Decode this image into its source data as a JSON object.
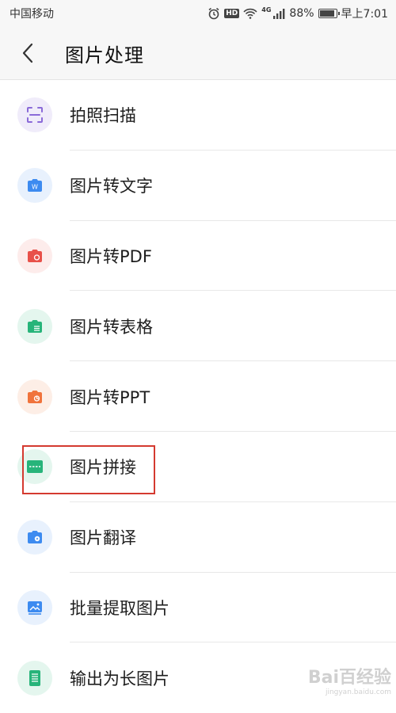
{
  "status_bar": {
    "carrier": "中国移动",
    "network": "4G",
    "battery": "88%",
    "time": "早上7:01",
    "hd": "HD"
  },
  "header": {
    "title": "图片处理"
  },
  "items": [
    {
      "label": "拍照扫描",
      "icon": "scan-icon",
      "color": "#8a6ad8",
      "bg": "#f0ecfa"
    },
    {
      "label": "图片转文字",
      "icon": "camera-text-icon",
      "color": "#3d8bf0",
      "bg": "#e8f1fd"
    },
    {
      "label": "图片转PDF",
      "icon": "camera-pdf-icon",
      "color": "#e8514a",
      "bg": "#fdeceb"
    },
    {
      "label": "图片转表格",
      "icon": "camera-table-icon",
      "color": "#27b47a",
      "bg": "#e4f6ee"
    },
    {
      "label": "图片转PPT",
      "icon": "camera-ppt-icon",
      "color": "#f0733c",
      "bg": "#fdeee6"
    },
    {
      "label": "图片拼接",
      "icon": "image-stitch-icon",
      "color": "#27b47a",
      "bg": "#e4f6ee"
    },
    {
      "label": "图片翻译",
      "icon": "camera-translate-icon",
      "color": "#3d8bf0",
      "bg": "#e8f1fd"
    },
    {
      "label": "批量提取图片",
      "icon": "extract-images-icon",
      "color": "#3d8bf0",
      "bg": "#e8f1fd"
    },
    {
      "label": "输出为长图片",
      "icon": "long-image-icon",
      "color": "#27b47a",
      "bg": "#e4f6ee"
    }
  ],
  "watermark": {
    "text": "Bai百经验",
    "sub": "jingyan.baidu.com"
  },
  "colors": {
    "highlight_border": "#d43a30"
  }
}
